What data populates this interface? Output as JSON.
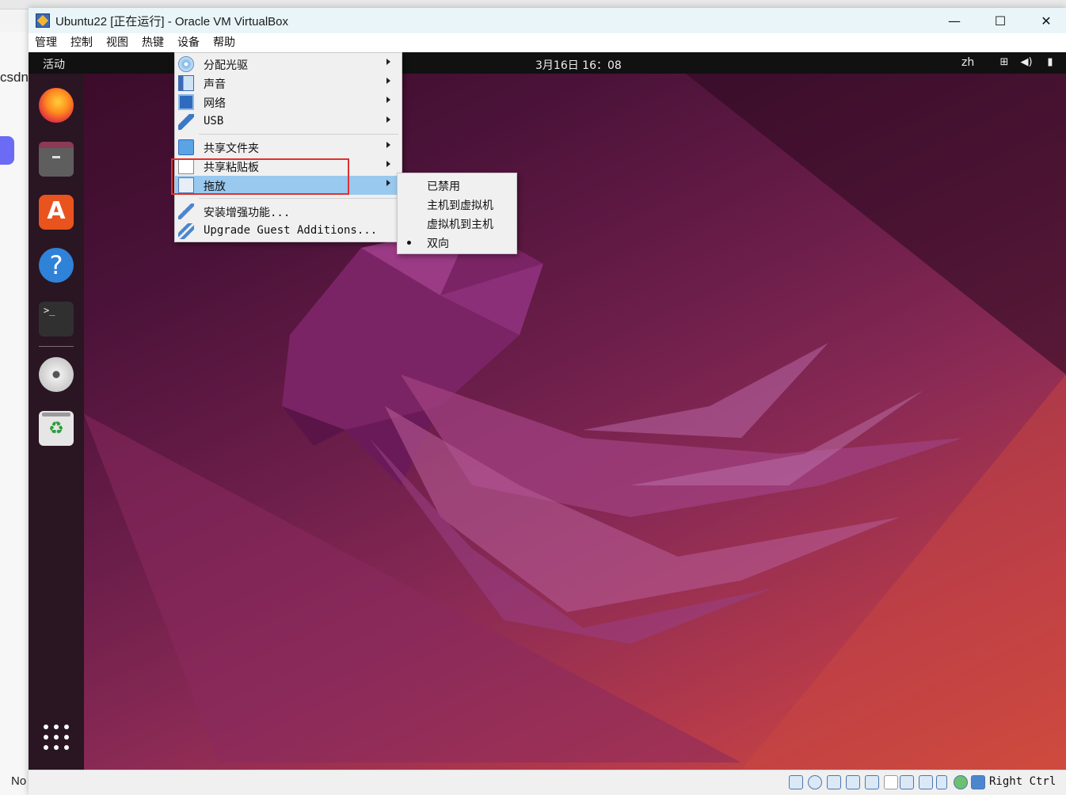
{
  "window": {
    "title": "Ubuntu22 [正在运行] - Oracle VM VirtualBox",
    "minimize_glyph": "—",
    "maximize_glyph": "☐",
    "close_glyph": "✕"
  },
  "menubar": [
    "管理",
    "控制",
    "视图",
    "热键",
    "设备",
    "帮助"
  ],
  "background_page": {
    "left_text": "csdn.",
    "bottom_text": "No"
  },
  "gnome": {
    "activities": "活动",
    "clock": "3月16日  16：08",
    "lang": "zh",
    "tray_icons": [
      "network-icon",
      "volume-icon",
      "power-icon"
    ],
    "dock": [
      "firefox",
      "files",
      "app-center",
      "help",
      "terminal",
      "dvd",
      "trash",
      "show-apps"
    ],
    "terminal_glyph": ">_",
    "help_glyph": "?",
    "store_glyph": "A",
    "trash_glyph": "♻"
  },
  "devices_menu": {
    "items": [
      {
        "label": "分配光驱",
        "icon": "optical-drive-icon",
        "submenu": true
      },
      {
        "label": "声音",
        "icon": "audio-icon",
        "submenu": true
      },
      {
        "label": "网络",
        "icon": "network-icon",
        "submenu": true
      },
      {
        "label": "USB",
        "icon": "usb-icon",
        "submenu": true
      },
      {
        "label": "共享文件夹",
        "icon": "shared-folder-icon",
        "submenu": true
      },
      {
        "label": "共享粘贴板",
        "icon": "shared-clipboard-icon",
        "submenu": true
      },
      {
        "label": "拖放",
        "icon": "drag-drop-icon",
        "submenu": true,
        "highlighted": true
      },
      {
        "label": "安装增强功能...",
        "icon": "install-additions-icon",
        "submenu": false
      },
      {
        "label": "Upgrade Guest Additions...",
        "icon": "upgrade-additions-icon",
        "submenu": false
      }
    ]
  },
  "drag_drop_submenu": {
    "items": [
      {
        "label": "已禁用",
        "selected": false
      },
      {
        "label": "主机到虚拟机",
        "selected": false
      },
      {
        "label": "虚拟机到主机",
        "selected": false
      },
      {
        "label": "双向",
        "selected": true
      }
    ]
  },
  "statusbar": {
    "host_key": "Right Ctrl"
  },
  "colors": {
    "menu_highlight": "#99c9ef",
    "annotation_box": "#e03030",
    "desktop_gradient_start": "#3a0b28",
    "desktop_gradient_end": "#d4503c"
  }
}
